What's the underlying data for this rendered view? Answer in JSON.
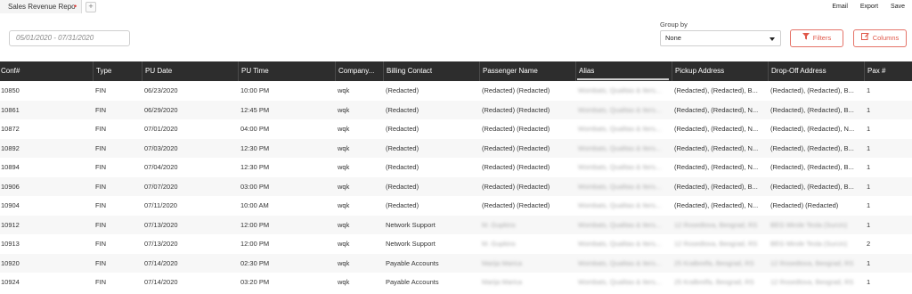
{
  "tab": {
    "title": "Sales Revenue Repo",
    "dirty_marker": "•",
    "add_label": "+"
  },
  "top_actions": [
    "Email",
    "Export",
    "Save"
  ],
  "filters": {
    "date_range_placeholder": "05/01/2020 - 07/31/2020",
    "group_by_label": "Group by",
    "group_by_value": "None",
    "filters_button": "Filters",
    "columns_button": "Columns",
    "accent_color": "#e0584a"
  },
  "table": {
    "columns": [
      "Conf#",
      "Type",
      "PU Date",
      "PU Time",
      "Company...",
      "Billing Contact",
      "Passenger Name",
      "Alias",
      "Pickup Address",
      "Drop-Off Address",
      "Pax #"
    ],
    "rows": [
      [
        "10850",
        "FIN",
        "06/23/2020",
        "10:00 PM",
        "wqk",
        "(Redacted)",
        "(Redacted) (Redacted)",
        "Wombats, Qualitas & Iters...",
        "(Redacted), (Redacted), B...",
        "(Redacted), (Redacted), B...",
        "1"
      ],
      [
        "10861",
        "FIN",
        "06/29/2020",
        "12:45 PM",
        "wqk",
        "(Redacted)",
        "(Redacted) (Redacted)",
        "Wombats, Qualitas & Iters...",
        "(Redacted), (Redacted), N...",
        "(Redacted), (Redacted), B...",
        "1"
      ],
      [
        "10872",
        "FIN",
        "07/01/2020",
        "04:00 PM",
        "wqk",
        "(Redacted)",
        "(Redacted) (Redacted)",
        "Wombats, Qualitas & Iters...",
        "(Redacted), (Redacted), N...",
        "(Redacted), (Redacted), N...",
        "1"
      ],
      [
        "10892",
        "FIN",
        "07/03/2020",
        "12:30 PM",
        "wqk",
        "(Redacted)",
        "(Redacted) (Redacted)",
        "Wombats, Qualitas & Iters...",
        "(Redacted), (Redacted), N...",
        "(Redacted), (Redacted), B...",
        "1"
      ],
      [
        "10894",
        "FIN",
        "07/04/2020",
        "12:30 PM",
        "wqk",
        "(Redacted)",
        "(Redacted) (Redacted)",
        "Wombats, Qualitas & Iters...",
        "(Redacted), (Redacted), N...",
        "(Redacted), (Redacted), B...",
        "1"
      ],
      [
        "10906",
        "FIN",
        "07/07/2020",
        "03:00 PM",
        "wqk",
        "(Redacted)",
        "(Redacted) (Redacted)",
        "Wombats, Qualitas & Iters...",
        "(Redacted), (Redacted), B...",
        "(Redacted), (Redacted), B...",
        "1"
      ],
      [
        "10904",
        "FIN",
        "07/11/2020",
        "10:00 AM",
        "wqk",
        "(Redacted)",
        "(Redacted) (Redacted)",
        "Wombats, Qualitas & Iters...",
        "(Redacted), (Redacted), N...",
        "(Redacted) (Redacted)",
        "1"
      ],
      [
        "10912",
        "FIN",
        "07/13/2020",
        "12:00 PM",
        "wqk",
        "Network Support",
        "M. Gupkins",
        "Wombats, Qualitas & Iters...",
        "12 Rosedtova, Beograd, RS",
        "BEG Mirole Tesla (Surcin)",
        "1"
      ],
      [
        "10913",
        "FIN",
        "07/13/2020",
        "12:00 PM",
        "wqk",
        "Network Support",
        "M. Gupkins",
        "Wombats, Qualitas & Iters...",
        "12 Rosedtova, Beograd, RS",
        "BEG Mirole Tesla (Surcin)",
        "2"
      ],
      [
        "10920",
        "FIN",
        "07/14/2020",
        "02:30 PM",
        "wqk",
        "Payable Accounts",
        "Marija Marica",
        "Wombats, Qualitas & Iters...",
        "25 Kralbrelfa, Beograd, RS",
        "12 Rosedtova, Beograd, RS",
        "1"
      ],
      [
        "10924",
        "FIN",
        "07/14/2020",
        "03:20 PM",
        "wqk",
        "Payable Accounts",
        "Marija Marica",
        "Wombats, Qualitas & Iters...",
        "25 Kralbrelfa, Beograd, RS",
        "12 Rosedtova, Beograd, RS",
        "1"
      ]
    ]
  }
}
